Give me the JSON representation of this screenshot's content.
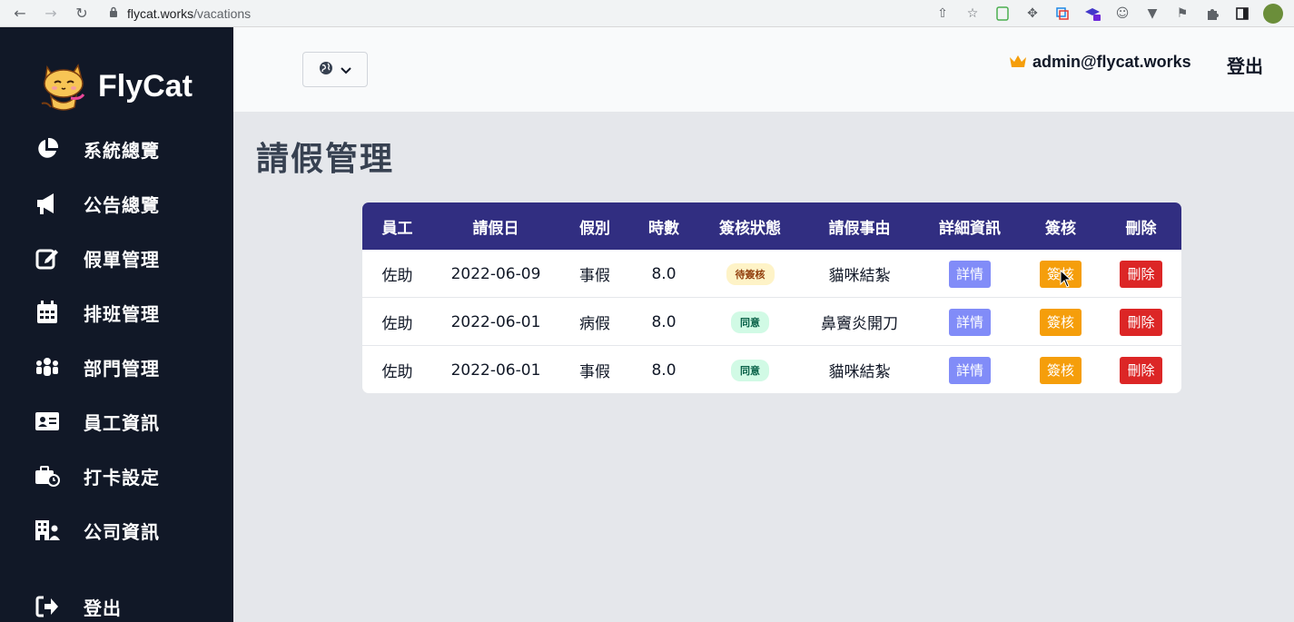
{
  "browser": {
    "host": "flycat.works",
    "path": "/vacations"
  },
  "brand": {
    "name": "FlyCat"
  },
  "sidebar": {
    "items": [
      {
        "label": "系統總覽",
        "icon": "pie-chart-icon"
      },
      {
        "label": "公告總覽",
        "icon": "megaphone-icon"
      },
      {
        "label": "假單管理",
        "icon": "edit-icon"
      },
      {
        "label": "排班管理",
        "icon": "calendar-icon"
      },
      {
        "label": "部門管理",
        "icon": "people-group-icon"
      },
      {
        "label": "員工資訊",
        "icon": "id-card-icon"
      },
      {
        "label": "打卡設定",
        "icon": "briefcase-clock-icon"
      },
      {
        "label": "公司資訊",
        "icon": "building-user-icon"
      }
    ],
    "logout": {
      "label": "登出",
      "icon": "sign-out-icon"
    }
  },
  "header": {
    "user_email": "admin@flycat.works",
    "logout_label": "登出",
    "colors": {
      "crown": "#f59e0b"
    }
  },
  "main": {
    "title": "請假管理",
    "table": {
      "columns": [
        "員工",
        "請假日",
        "假別",
        "時數",
        "簽核狀態",
        "請假事由",
        "詳細資訊",
        "簽核",
        "刪除"
      ],
      "rows": [
        {
          "employee": "佐助",
          "date": "2022-06-09",
          "type": "事假",
          "hours": "8.0",
          "status": "待簽核",
          "status_kind": "pending",
          "reason": "貓咪結紮",
          "detail_label": "詳情",
          "approve_label": "簽核",
          "delete_label": "刪除"
        },
        {
          "employee": "佐助",
          "date": "2022-06-01",
          "type": "病假",
          "hours": "8.0",
          "status": "同意",
          "status_kind": "approved",
          "reason": "鼻竇炎開刀",
          "detail_label": "詳情",
          "approve_label": "簽核",
          "delete_label": "刪除"
        },
        {
          "employee": "佐助",
          "date": "2022-06-01",
          "type": "事假",
          "hours": "8.0",
          "status": "同意",
          "status_kind": "approved",
          "reason": "貓咪結紮",
          "detail_label": "詳情",
          "approve_label": "簽核",
          "delete_label": "刪除"
        }
      ]
    }
  },
  "colors": {
    "sidebar_bg": "#111827",
    "table_header_bg": "#312e81",
    "detail_button": "#818cf8",
    "approve_button": "#f59e0b",
    "delete_button": "#dc2626",
    "pending_badge_bg": "#fef3c7",
    "pending_badge_text": "#92400e",
    "approved_badge_bg": "#d1fae5",
    "approved_badge_text": "#065f46"
  }
}
